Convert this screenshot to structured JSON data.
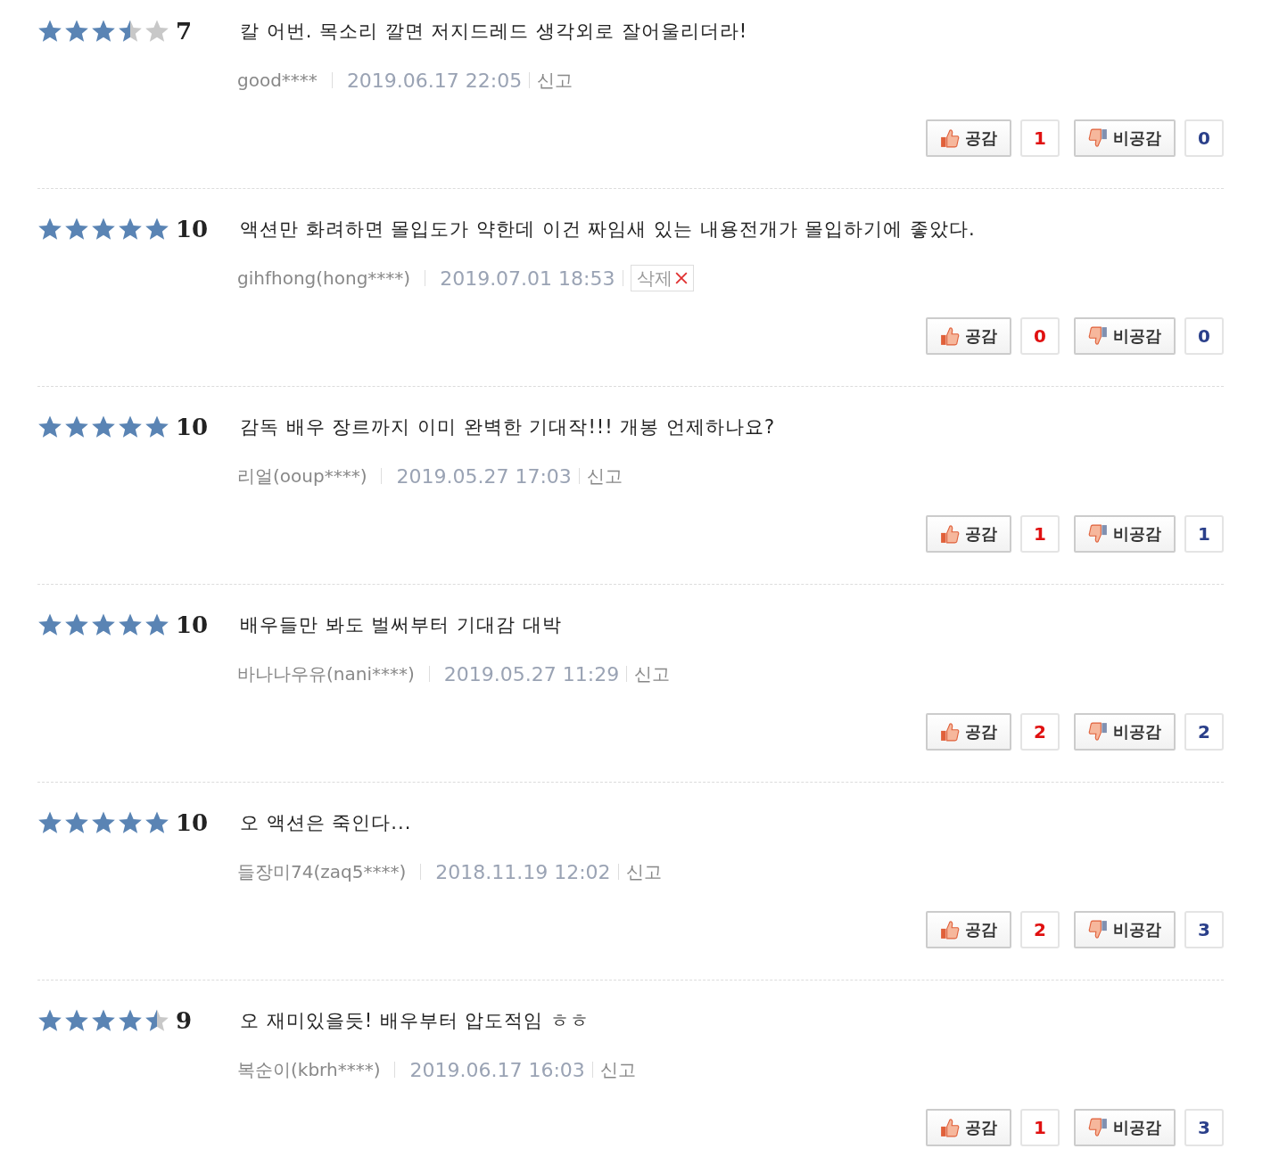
{
  "reviews": [
    {
      "stars": 3.5,
      "score": "7",
      "text": "칼 어번. 목소리 깔면 저지드레드 생각외로 잘어울리더라!",
      "author": "good****",
      "date": "2019.06.17 22:05",
      "action": {
        "kind": "report",
        "label": "신고"
      },
      "like": {
        "label": "공감",
        "count": "1"
      },
      "dislike": {
        "label": "비공감",
        "count": "0"
      }
    },
    {
      "stars": 5,
      "score": "10",
      "text": "액션만 화려하면 몰입도가 약한데 이건 짜임새 있는 내용전개가 몰입하기에 좋았다.",
      "author": "gihfhong(hong****)",
      "date": "2019.07.01 18:53",
      "action": {
        "kind": "delete",
        "label": "삭제"
      },
      "like": {
        "label": "공감",
        "count": "0"
      },
      "dislike": {
        "label": "비공감",
        "count": "0"
      }
    },
    {
      "stars": 5,
      "score": "10",
      "text": "감독 배우 장르까지 이미 완벽한 기대작!!! 개봉 언제하나요?",
      "author": "리얼(ooup****)",
      "date": "2019.05.27 17:03",
      "action": {
        "kind": "report",
        "label": "신고"
      },
      "like": {
        "label": "공감",
        "count": "1"
      },
      "dislike": {
        "label": "비공감",
        "count": "1"
      }
    },
    {
      "stars": 5,
      "score": "10",
      "text": "배우들만 봐도 벌써부터 기대감 대박",
      "author": "바나나우유(nani****)",
      "date": "2019.05.27 11:29",
      "action": {
        "kind": "report",
        "label": "신고"
      },
      "like": {
        "label": "공감",
        "count": "2"
      },
      "dislike": {
        "label": "비공감",
        "count": "2"
      }
    },
    {
      "stars": 5,
      "score": "10",
      "text": "오 액션은 죽인다...",
      "author": "들장미74(zaq5****)",
      "date": "2018.11.19 12:02",
      "action": {
        "kind": "report",
        "label": "신고"
      },
      "like": {
        "label": "공감",
        "count": "2"
      },
      "dislike": {
        "label": "비공감",
        "count": "3"
      }
    },
    {
      "stars": 4.5,
      "score": "9",
      "text": "오 재미있을듯! 배우부터 압도적임 ㅎㅎ",
      "author": "복순이(kbrh****)",
      "date": "2019.06.17 16:03",
      "action": {
        "kind": "report",
        "label": "신고"
      },
      "like": {
        "label": "공감",
        "count": "1"
      },
      "dislike": {
        "label": "비공감",
        "count": "3"
      }
    }
  ]
}
